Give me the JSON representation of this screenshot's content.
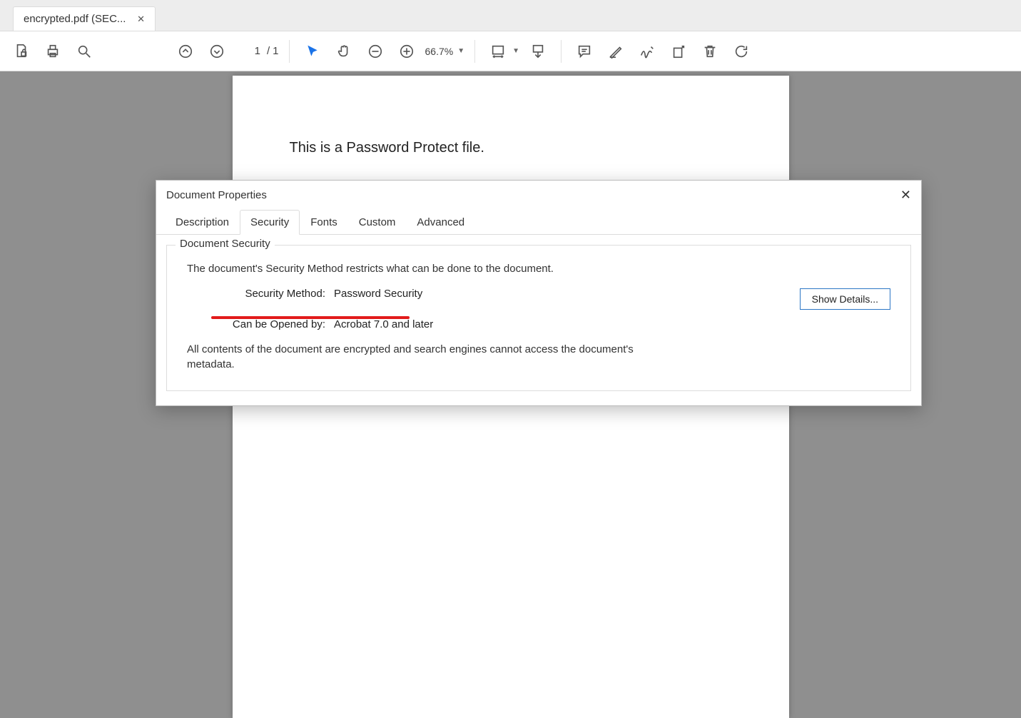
{
  "tab": {
    "title": "encrypted.pdf (SEC..."
  },
  "toolbar": {
    "page_current": "1",
    "page_sep": "/",
    "page_total": "1",
    "zoom": "66.7%"
  },
  "document": {
    "body_text": "This is a Password Protect file."
  },
  "dialog": {
    "title": "Document Properties",
    "tabs": {
      "description": "Description",
      "security": "Security",
      "fonts": "Fonts",
      "custom": "Custom",
      "advanced": "Advanced"
    },
    "security": {
      "legend": "Document Security",
      "intro": "The document's Security Method restricts what can be done to the document.",
      "method_label": "Security Method:",
      "method_value": "Password Security",
      "opened_label": "Can be Opened by:",
      "opened_value": "Acrobat 7.0 and later",
      "encrypted_note": "All contents of the document are encrypted and search engines cannot access the document's metadata.",
      "details_btn": "Show Details..."
    }
  }
}
